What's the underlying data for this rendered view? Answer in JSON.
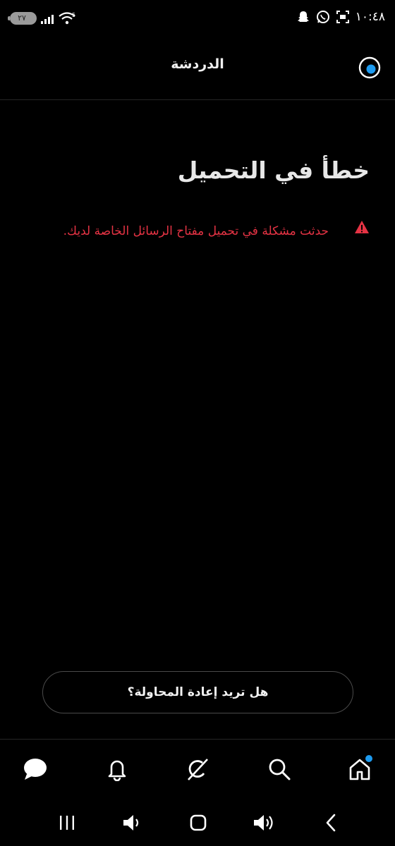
{
  "status_bar": {
    "time": "١٠:٤٨",
    "battery": "٢٧",
    "network": "5"
  },
  "header": {
    "title": "الدردشة"
  },
  "error": {
    "title": "خطأ في التحميل",
    "message": "حدثت مشكلة في تحميل مفتاح الرسائل الخاصة لديك.",
    "color": "#e53344"
  },
  "retry": {
    "label": "هل تريد إعادة المحاولة؟"
  },
  "bottom_nav": {
    "items": [
      "messages-icon",
      "notifications-icon",
      "grok-icon",
      "search-icon",
      "home-icon"
    ],
    "badge_color": "#1d9bf0"
  },
  "system_nav": {
    "items": [
      "recents-icon",
      "volume-down-icon",
      "home-circle-icon",
      "volume-up-icon",
      "back-icon"
    ]
  }
}
